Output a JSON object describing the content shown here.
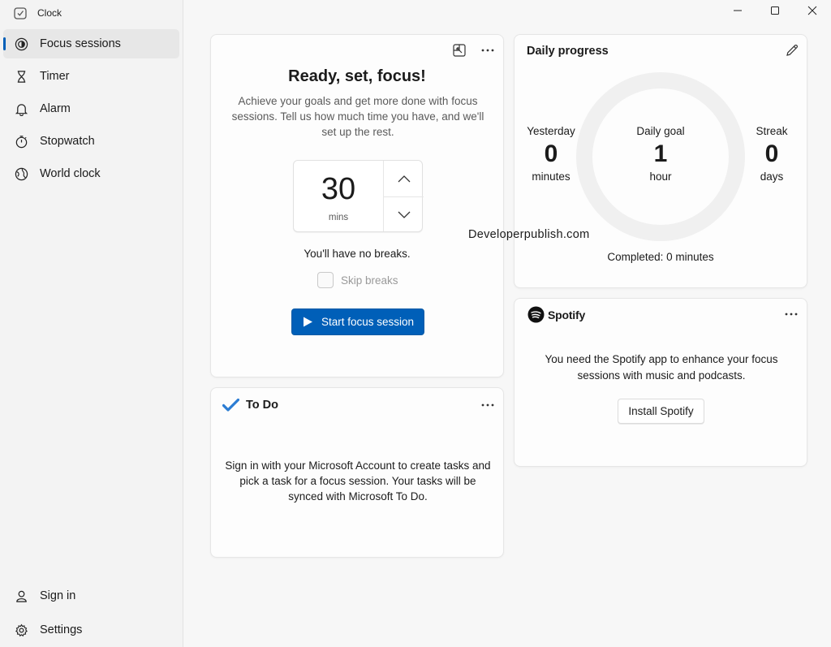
{
  "app": {
    "title": "Clock"
  },
  "nav": {
    "items": [
      {
        "label": "Focus sessions",
        "icon": "focus-icon",
        "active": true
      },
      {
        "label": "Timer",
        "icon": "hourglass-icon"
      },
      {
        "label": "Alarm",
        "icon": "bell-icon"
      },
      {
        "label": "Stopwatch",
        "icon": "stopwatch-icon"
      },
      {
        "label": "World clock",
        "icon": "globe-icon"
      }
    ],
    "bottom": [
      {
        "label": "Sign in",
        "icon": "person-icon"
      },
      {
        "label": "Settings",
        "icon": "gear-icon"
      }
    ]
  },
  "focus": {
    "heading": "Ready, set, focus!",
    "description": "Achieve your goals and get more done with focus sessions. Tell us how much time you have, and we'll set up the rest.",
    "minutes": "30",
    "unit": "mins",
    "breaks_text": "You'll have no breaks.",
    "skip_label": "Skip breaks",
    "start_label": "Start focus session"
  },
  "todo": {
    "title": "To Do",
    "message": "Sign in with your Microsoft Account to create tasks and pick a task for a focus session. Your tasks will be synced with Microsoft To Do."
  },
  "progress": {
    "title": "Daily progress",
    "yesterday": {
      "label": "Yesterday",
      "value": "0",
      "unit": "minutes"
    },
    "goal": {
      "label": "Daily goal",
      "value": "1",
      "unit": "hour"
    },
    "streak": {
      "label": "Streak",
      "value": "0",
      "unit": "days"
    },
    "completed": "Completed: 0 minutes",
    "completion_fraction": 0
  },
  "spotify": {
    "brand": "Spotify",
    "message": "You need the Spotify app to enhance your focus sessions with music and podcasts.",
    "install_label": "Install Spotify"
  },
  "watermark": "Developerpublish.com",
  "colors": {
    "accent": "#005fb8",
    "ring": "#f0f0f0"
  }
}
